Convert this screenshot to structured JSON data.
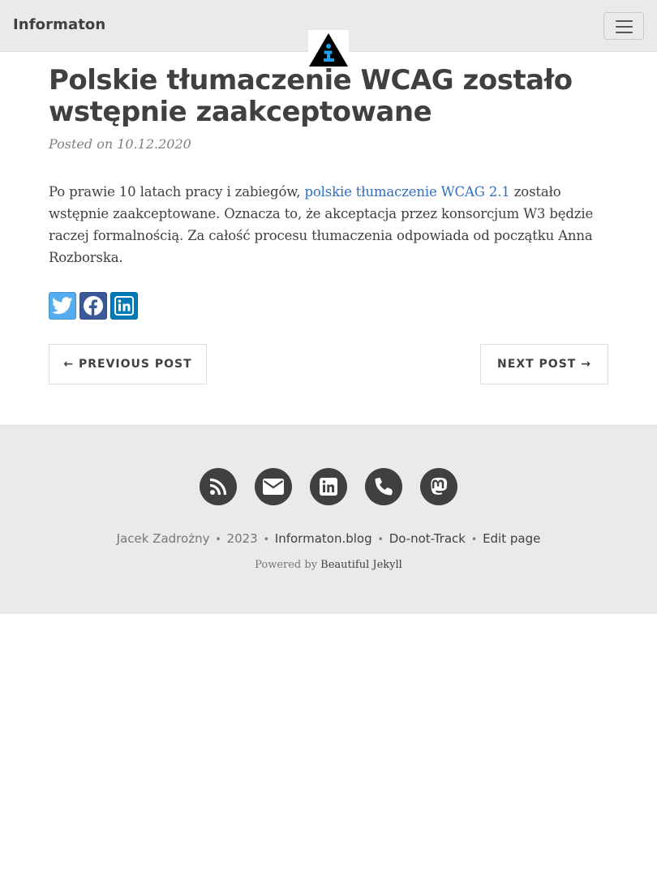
{
  "navbar": {
    "brand": "Informaton",
    "menu_icon": "hamburger-icon",
    "logo_icon": "info-triangle-logo"
  },
  "post": {
    "title": "Polskie tłumaczenie WCAG zostało wstępnie zaakceptowane",
    "meta": "Posted on 10.12.2020",
    "body_before_link": "Po prawie 10 latach pracy i zabiegów, ",
    "body_link": "polskie tłumaczenie WCAG 2.1",
    "body_after_link": " zostało wstępnie zaakceptowane. Oznacza to, że akceptacja przez konsorcjum W3 będzie raczej formalnością. Za całość procesu tłumaczenia odpowiada od początku Anna Rozborska."
  },
  "share": [
    {
      "icon": "twitter-icon",
      "color": "#55acee"
    },
    {
      "icon": "facebook-icon",
      "color": "#3b5998"
    },
    {
      "icon": "linkedin-icon",
      "color": "#007bb5"
    }
  ],
  "pager": {
    "prev_label": "← Previous Post",
    "next_label": "Next Post →"
  },
  "footer": {
    "social_icons": [
      "rss-icon",
      "envelope-icon",
      "linkedin-icon",
      "phone-icon",
      "mastodon-icon"
    ],
    "author": "Jacek Zadrożny",
    "year": "2023",
    "site_link": "Informaton.blog",
    "dnt_link": "Do-not-Track",
    "edit_link": "Edit page",
    "powered_prefix": "Powered by ",
    "powered_link": "Beautiful Jekyll"
  },
  "colors": {
    "navbar_bg": "#eaeaea",
    "text": "#404040",
    "link": "#2f6fc4",
    "footer_bg": "#eaeaea"
  }
}
